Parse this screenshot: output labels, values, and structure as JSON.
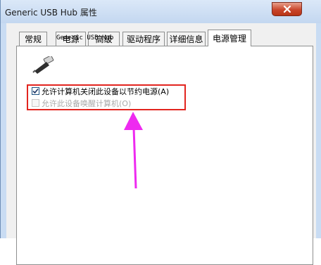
{
  "window": {
    "title": "Generic USB Hub 属性",
    "close_symbol": "✕"
  },
  "tabs": [
    {
      "label": "常规",
      "active": false
    },
    {
      "label": "电源",
      "active": false
    },
    {
      "label": "高级",
      "active": false
    },
    {
      "label": "驱动程序",
      "active": false
    },
    {
      "label": "详细信息",
      "active": false
    },
    {
      "label": "电源管理",
      "active": true
    }
  ],
  "device": {
    "name": "Generic USB Hub",
    "icon": "usb-plug-icon"
  },
  "options": [
    {
      "label": "允许计算机关闭此设备以节约电源(A)",
      "checked": true,
      "enabled": true
    },
    {
      "label": "允许此设备唤醒计算机(O)",
      "checked": false,
      "enabled": false
    }
  ],
  "annotation": {
    "highlight_color": "#e2251f",
    "arrow_color": "#ee2af0"
  }
}
